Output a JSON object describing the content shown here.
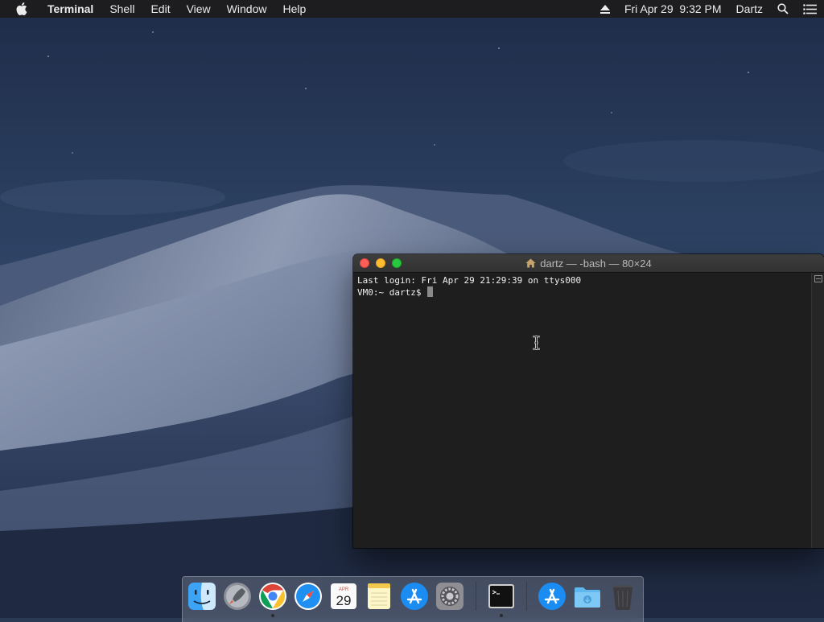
{
  "menubar": {
    "app_name": "Terminal",
    "menus": [
      "Shell",
      "Edit",
      "View",
      "Window",
      "Help"
    ],
    "clock": "Fri Apr 29  9:32 PM",
    "user": "Dartz",
    "icons": [
      "apple-icon",
      "eject-icon",
      "spotlight-search-icon",
      "notification-center-icon"
    ]
  },
  "terminal": {
    "title": "dartz — -bash — 80×24",
    "lines": [
      "Last login: Fri Apr 29 21:29:39 on ttys000",
      "VM0:~ dartz$ "
    ],
    "colors": {
      "background": "#1e1e1e",
      "text": "#f0f0f0"
    }
  },
  "dock": {
    "apps": [
      {
        "name": "Finder",
        "icon": "finder-icon",
        "running": true
      },
      {
        "name": "Launchpad",
        "icon": "launchpad-icon",
        "running": false
      },
      {
        "name": "Google Chrome",
        "icon": "chrome-icon",
        "running": true
      },
      {
        "name": "Safari",
        "icon": "safari-icon",
        "running": false
      },
      {
        "name": "Calendar",
        "icon": "calendar-icon",
        "running": false,
        "month": "APR",
        "day": "29"
      },
      {
        "name": "Notes",
        "icon": "notes-icon",
        "running": false
      },
      {
        "name": "App Store",
        "icon": "app-store-icon",
        "running": false
      },
      {
        "name": "System Preferences",
        "icon": "system-preferences-icon",
        "running": false
      },
      {
        "name": "Terminal",
        "icon": "terminal-icon",
        "running": true
      },
      {
        "name": "Applications",
        "icon": "app-store-folder-icon",
        "running": false
      },
      {
        "name": "Downloads",
        "icon": "downloads-folder-icon",
        "running": false
      },
      {
        "name": "Trash",
        "icon": "trash-icon",
        "running": false
      }
    ]
  }
}
